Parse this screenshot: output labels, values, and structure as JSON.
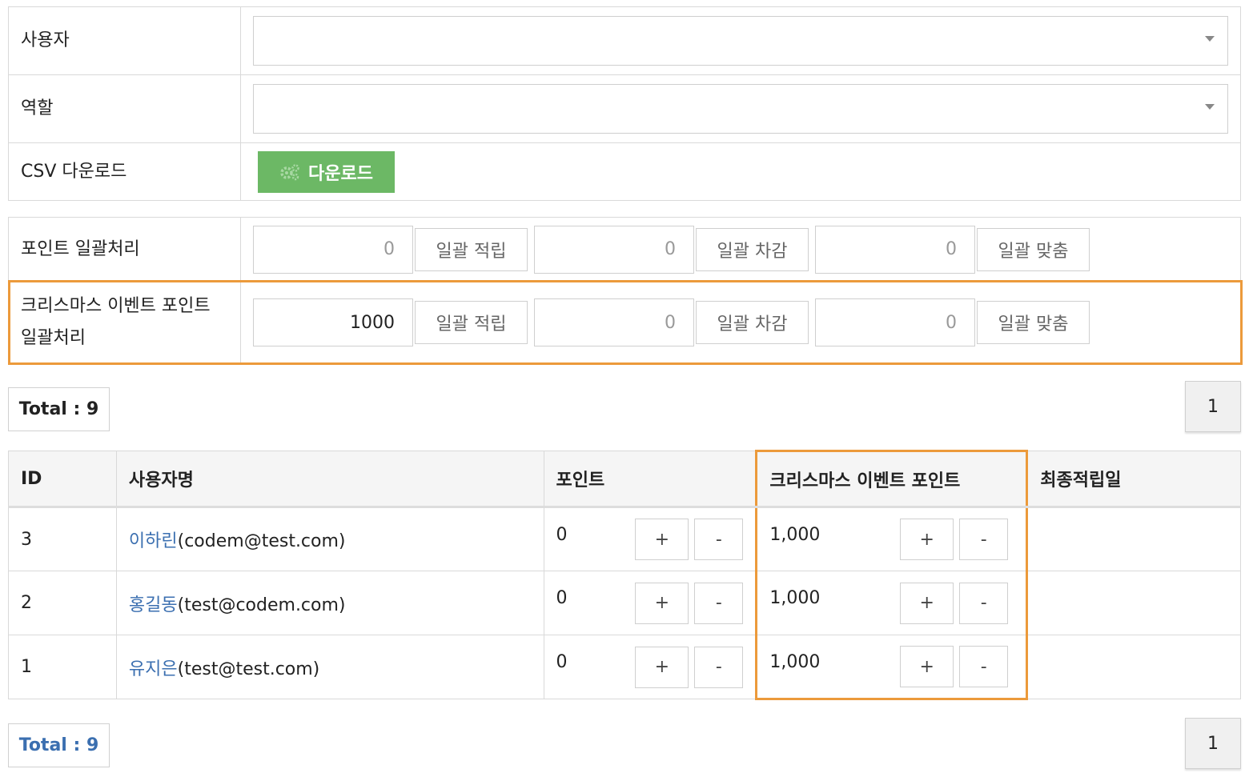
{
  "filters": {
    "user_label": "사용자",
    "role_label": "역할",
    "csv_label": "CSV 다운로드",
    "download_button": "다운로드"
  },
  "bulk": {
    "points_label": "포인트 일괄처리",
    "xmas_label": "크리스마스 이벤트 포인트 일괄처리",
    "accrue_label": "일괄 적립",
    "deduct_label": "일괄 차감",
    "set_label": "일괄 맞춤",
    "points_values": [
      "0",
      "0",
      "0"
    ],
    "xmas_values": [
      "1000",
      "0",
      "0"
    ]
  },
  "pagination": {
    "total_label": "Total : 9",
    "current_page": "1"
  },
  "table": {
    "headers": [
      "ID",
      "사용자명",
      "포인트",
      "크리스마스 이벤트 포인트",
      "최종적립일"
    ],
    "rows": [
      {
        "id": "3",
        "name": "이하린",
        "email": "(codem@test.com)",
        "points": "0",
        "xmas": "1,000",
        "last_date": ""
      },
      {
        "id": "2",
        "name": "홍길동",
        "email": "(test@codem.com)",
        "points": "0",
        "xmas": "1,000",
        "last_date": ""
      },
      {
        "id": "1",
        "name": "유지은",
        "email": "(test@test.com)",
        "points": "0",
        "xmas": "1,000",
        "last_date": ""
      }
    ],
    "plus_label": "+",
    "minus_label": "-"
  },
  "colors": {
    "highlight": "#ec9a3b",
    "download_green": "#6cb865",
    "link_blue": "#3b6fb0"
  }
}
